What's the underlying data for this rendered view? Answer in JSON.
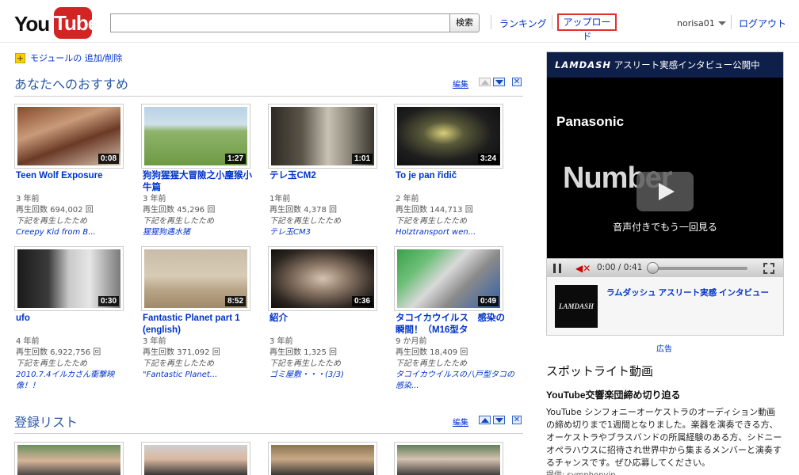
{
  "header": {
    "logo_you": "You",
    "logo_tube": "Tube",
    "search_placeholder": "",
    "search_button": "検索",
    "ranking": "ランキング",
    "upload": "アップロード",
    "username": "norisa01",
    "logout": "ログアウト"
  },
  "modules": {
    "add_remove": "モジュールの 追加/削除"
  },
  "recommended": {
    "title": "あなたへのおすすめ",
    "edit": "編集",
    "videos": [
      {
        "title": "Teen Wolf Exposure",
        "duration": "0:08",
        "age": "3 年前",
        "views": "再生回数 694,002 回",
        "reason": "下記を再生したため",
        "source": "Creepy Kid from B..."
      },
      {
        "title": "狗狗猩猩大冒險之小塵猴小牛篇",
        "duration": "1:27",
        "age": "3 年前",
        "views": "再生回数 45,296 回",
        "reason": "下記を再生したため",
        "source": "猩猩狗遇水猪"
      },
      {
        "title": "テレ玉CM2",
        "duration": "1:01",
        "age": "1年前",
        "views": "再生回数 4,378 回",
        "reason": "下記を再生したため",
        "source": "テレ玉CM3"
      },
      {
        "title": "To je pan řidič",
        "duration": "3:24",
        "age": "2 年前",
        "views": "再生回数 144,713 回",
        "reason": "下記を再生したため",
        "source": "Holztransport wen..."
      },
      {
        "title": "ufo",
        "duration": "0:30",
        "age": "4 年前",
        "views": "再生回数 6,922,756 回",
        "reason": "下記を再生したため",
        "source": "2010.7.4イルカさん衝撃映像！！"
      },
      {
        "title": "Fantastic Planet part 1 (english)",
        "duration": "8:52",
        "age": "3 年前",
        "views": "再生回数 371,092 回",
        "reason": "下記を再生したため",
        "source": "\"Fantastic Planet..."
      },
      {
        "title": "紹介",
        "duration": "0:36",
        "age": "3 年前",
        "views": "再生回数 1,325 回",
        "reason": "下記を再生したため",
        "source": "ゴミ屋敷・・・(3/3)"
      },
      {
        "title": "タコイカウイルス　感染の瞬間！（M16型タ",
        "duration": "0:49",
        "age": "9 か月前",
        "views": "再生回数 18,409 回",
        "reason": "下記を再生したため",
        "source": "タコイカウイルスの八戸型タコの感染..."
      }
    ]
  },
  "subscriptions": {
    "title": "登録リスト",
    "edit": "編集"
  },
  "ad": {
    "banner_brand": "LAMDASH",
    "banner_text": "アスリート実感インタビュー公開中",
    "brand": "Panasonic",
    "number": "Number",
    "caption": "音声付きでもう一回見る",
    "time": "0:00 / 0:41",
    "progress": 0,
    "logo_text": "LAMDASH",
    "promo_link": "ラムダッシュ アスリート実感 インタビュー",
    "label": "広告"
  },
  "spotlight": {
    "title": "スポットライト動画",
    "headline": "YouTube交響楽団締め切り迫る",
    "body": "YouTube シンフォニーオーケストラのオーディション動画の締め切りまで1週間となりました。楽器を演奏できる方、オーケストラやブラスバンドの所属経験のある方、シドニーオペラハウスに招待され世界中から集まるメンバーと演奏するチャンスです。ぜひ応募してください。",
    "provider": "提供: symphonyip"
  }
}
